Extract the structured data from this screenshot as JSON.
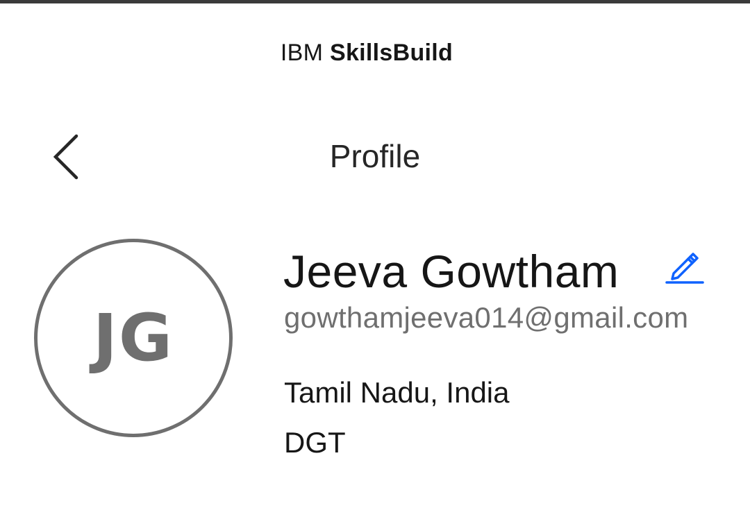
{
  "header": {
    "brand_ibm": "IBM",
    "brand_product": "SkillsBuild"
  },
  "nav": {
    "back_icon": "chevron-left-icon",
    "title": "Profile"
  },
  "profile": {
    "initials": "JG",
    "name": "Jeeva Gowtham",
    "edit_icon": "pencil-edit-icon",
    "email": "gowthamjeeva014@gmail.com",
    "location": "Tamil Nadu, India",
    "organization": "DGT"
  },
  "colors": {
    "text_primary": "#161616",
    "text_secondary": "#6f6f6f",
    "avatar": "#6f6f6f",
    "edit_accent": "#0f62fe",
    "top_border": "#3a3a3a"
  }
}
